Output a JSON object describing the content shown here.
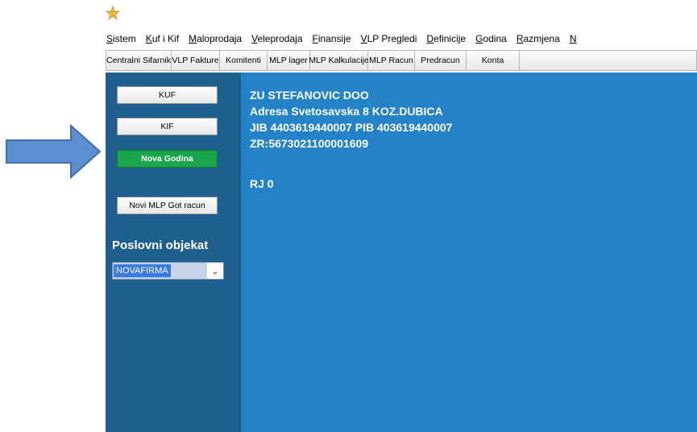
{
  "menu": [
    "Sistem",
    "Kuf i Kif",
    "Maloprodaja",
    "Veleprodaja",
    "Finansije",
    "VLP Pregledi",
    "Definicije",
    "Godina",
    "Razmjena",
    "N"
  ],
  "toolbar": [
    "Centralni Sifarnik",
    "VLP Fakture",
    "Komitenti",
    "MLP lager",
    "MLP Kalkulacije",
    "MLP Racun",
    "Predracun",
    "Konta"
  ],
  "sidebar": {
    "kuf": "KUF",
    "kif": "KIF",
    "nova_godina": "Nova Godina",
    "novi_mlp": "Novi MLP Got racun",
    "poslovni_objekat_label": "Poslovni objekat",
    "poslovni_objekat_value": "NOVAFIRMA"
  },
  "company": {
    "name": "ZU STEFANOVIC DOO",
    "address": "Adresa Svetosavska 8 KOZ.DUBICA",
    "ids": "JIB 4403619440007 PIB 403619440007",
    "zr": "ZR:5673021100001609",
    "rj": "RJ 0"
  },
  "colors": {
    "sidebar": "#1f5f8f",
    "main": "#2382c8",
    "highlight_button": "#1aa64a",
    "pointer_arrow": "#5b8fd0"
  }
}
